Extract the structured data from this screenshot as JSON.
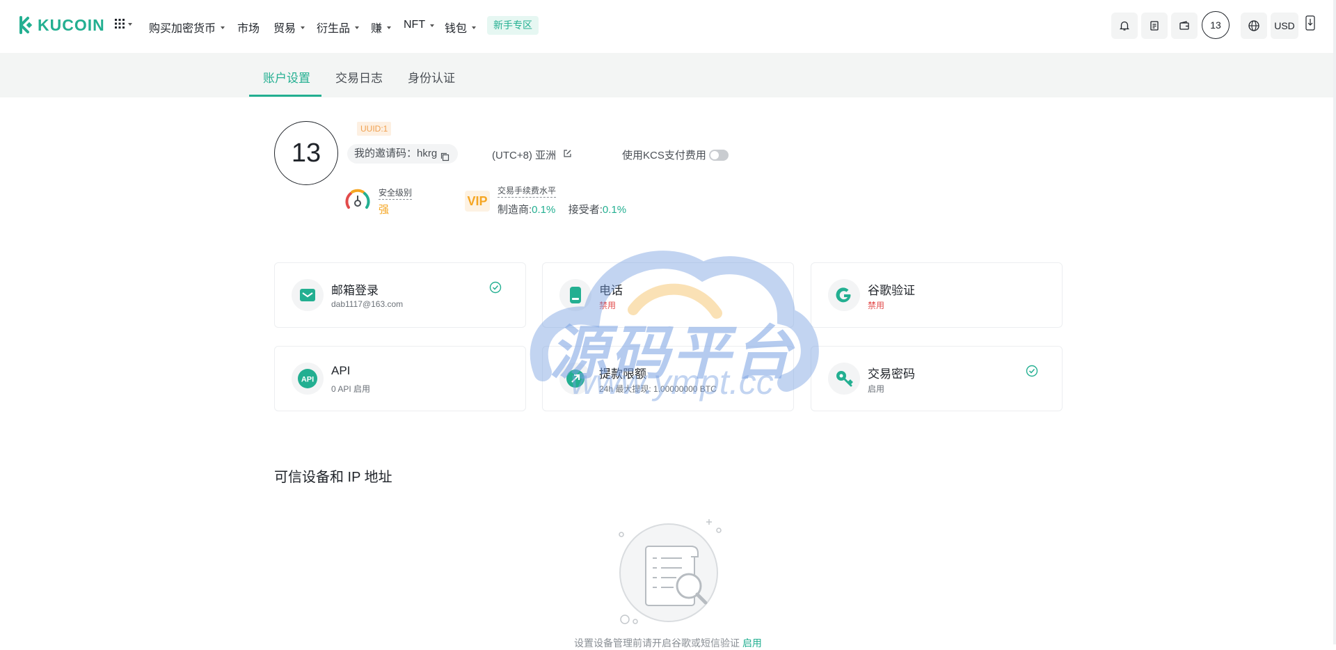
{
  "brand": {
    "name": "KUCOIN",
    "color": "#23af91"
  },
  "nav": {
    "items": [
      "购买加密货币",
      "市场",
      "贸易",
      "衍生品",
      "赚",
      "NFT",
      "钱包"
    ],
    "novice": "新手专区",
    "avatar": "13",
    "currency": "USD"
  },
  "tabs": [
    "账户设置",
    "交易日志",
    "身份认证"
  ],
  "profile": {
    "avatar": "13",
    "uuid": "UUID:1",
    "invite_label": "我的邀请码：",
    "invite_code": "hkrg",
    "timezone": "(UTC+8) 亚洲",
    "kcs_label": "使用KCS支付费用",
    "kcs_enabled": false,
    "security_label": "安全级别",
    "security_value": "强",
    "vip": "VIP",
    "fee_label": "交易手续费水平",
    "maker_label": "制造商:",
    "maker_value": "0.1%",
    "taker_label": "接受者:",
    "taker_value": "0.1%"
  },
  "cards": [
    {
      "title": "邮箱登录",
      "sub": "dab1117@163.com",
      "status": "ok",
      "icon": "mail-icon"
    },
    {
      "title": "电话",
      "sub": "禁用",
      "status": "disabled",
      "icon": "phone-icon"
    },
    {
      "title": "谷歌验证",
      "sub": "禁用",
      "status": "disabled",
      "icon": "google-icon"
    },
    {
      "title": "API",
      "sub": "0 API 启用",
      "status": "none",
      "icon": "api-icon"
    },
    {
      "title": "提款限额",
      "sub": "24h 最大提现: 1.00000000 BTC",
      "status": "none",
      "icon": "withdraw-limit-icon"
    },
    {
      "title": "交易密码",
      "sub": "启用",
      "status": "ok",
      "icon": "key-icon"
    }
  ],
  "trusted": {
    "title": "可信设备和 IP 地址",
    "empty_text": "设置设备管理前请开启谷歌或短信验证",
    "empty_link": "启用"
  },
  "watermark": {
    "big": "源码平台",
    "small": "www.ympt.cc"
  }
}
